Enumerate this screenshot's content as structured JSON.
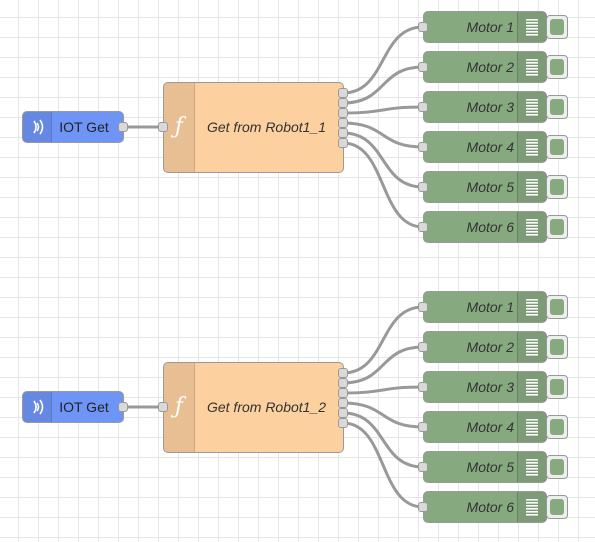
{
  "flows": [
    {
      "inject": {
        "label": "IOT Get",
        "icon": "inject-icon"
      },
      "function": {
        "label": "Get from Robot1_1",
        "icon": "function-icon",
        "glyph": "ƒ"
      },
      "debug_nodes": [
        {
          "label": "Motor 1"
        },
        {
          "label": "Motor 2"
        },
        {
          "label": "Motor 3"
        },
        {
          "label": "Motor 4"
        },
        {
          "label": "Motor 5"
        },
        {
          "label": "Motor 6"
        }
      ]
    },
    {
      "inject": {
        "label": "IOT Get",
        "icon": "inject-icon"
      },
      "function": {
        "label": "Get from Robot1_2",
        "icon": "function-icon",
        "glyph": "ƒ"
      },
      "debug_nodes": [
        {
          "label": "Motor 1"
        },
        {
          "label": "Motor 2"
        },
        {
          "label": "Motor 3"
        },
        {
          "label": "Motor 4"
        },
        {
          "label": "Motor 5"
        },
        {
          "label": "Motor 6"
        }
      ]
    }
  ],
  "colors": {
    "inject": "#6e94f6",
    "function": "#fcd09f",
    "debug": "#87a980",
    "wire": "#999999",
    "grid": "#e6e6e6"
  }
}
